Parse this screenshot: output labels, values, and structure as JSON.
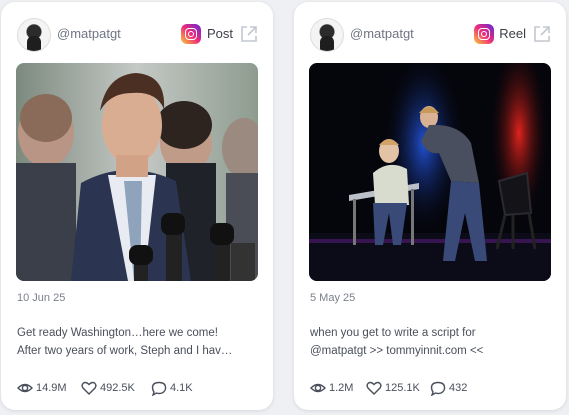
{
  "cards": [
    {
      "handle": "@matpatgt",
      "post_type": "Post",
      "platform_icon": "instagram-icon",
      "date": "10 Jun 25",
      "caption_lines": [
        "Get ready Washington…here we come!",
        "After two years of work, Steph and I hav…"
      ],
      "views": "14.9M",
      "likes": "492.5K",
      "comments": "4.1K"
    },
    {
      "handle": "@matpatgt",
      "post_type": "Reel",
      "platform_icon": "instagram-icon",
      "date": "5 May 25",
      "caption_lines": [
        "when you get to write a script for",
        "@matpatgt >> tommyinnit.com <<"
      ],
      "views": "1.2M",
      "likes": "125.1K",
      "comments": "432"
    }
  ],
  "colors": {
    "card_bg": "#ffffff",
    "page_bg": "#eef0f3",
    "muted_text": "#7a808c"
  }
}
